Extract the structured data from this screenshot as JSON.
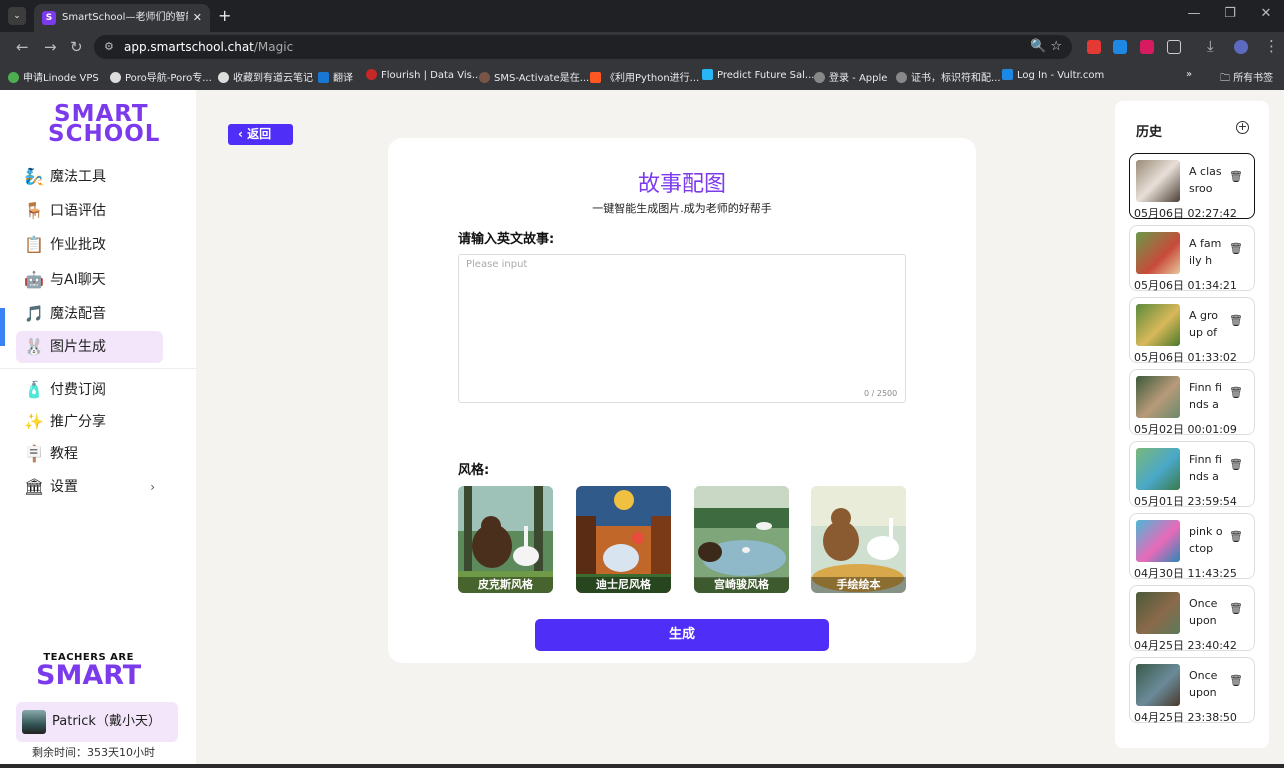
{
  "browser": {
    "tab_title": "SmartSchool—老师们的智能AI",
    "tab_icon_letter": "S",
    "url_host": "app.smartschool.chat",
    "url_path": "/Magic",
    "bookmarks": [
      "申请Linode VPS",
      "Poro导航-Poro专...",
      "收藏到有道云笔记",
      "翻译",
      "Flourish | Data Vis...",
      "SMS-Activate是在...",
      "《利用Python进行...",
      "Predict Future Sal...",
      "登录 - Apple",
      "证书，标识符和配...",
      "Log In - Vultr.com"
    ],
    "all_bookmarks": "所有书签"
  },
  "brand": {
    "logo_line1": "SMART",
    "logo_line2": "SCHOOL",
    "slogan_line1": "TEACHERS ARE",
    "slogan_line2": "SMART"
  },
  "nav": {
    "items": [
      {
        "label": "魔法工具",
        "icon": "🧞"
      },
      {
        "label": "口语评估",
        "icon": "🪑"
      },
      {
        "label": "作业批改",
        "icon": "📋"
      },
      {
        "label": "与AI聊天",
        "icon": "🤖"
      },
      {
        "label": "魔法配音",
        "icon": "🎵"
      },
      {
        "label": "图片生成",
        "icon": "🐰"
      }
    ],
    "bottom_items": [
      {
        "label": "付费订阅",
        "icon": "🧴"
      },
      {
        "label": "推广分享",
        "icon": "✨"
      },
      {
        "label": "教程",
        "icon": "🪧"
      },
      {
        "label": "设置",
        "icon": "🏛"
      }
    ],
    "settings_chevron": "›"
  },
  "user": {
    "name": "Patrick（戴小天）",
    "remaining": "剩余时间：353天10小时"
  },
  "main": {
    "back_label": "返回",
    "title": "故事配图",
    "subtitle": "一键智能生成图片.成为老师的好帮手",
    "story_label": "请输入英文故事:",
    "story_placeholder": "Please input",
    "char_count": "0 / 2500",
    "style_label": "风格:",
    "styles": [
      "皮克斯风格",
      "迪士尼风格",
      "宫崎骏风格",
      "手绘绘本"
    ],
    "generate_label": "生成"
  },
  "history": {
    "title": "历史",
    "items": [
      {
        "text": "A classroom",
        "date": "05月06日 02:27:42"
      },
      {
        "text": "A family h",
        "date": "05月06日 01:34:21"
      },
      {
        "text": "A group of",
        "date": "05月06日 01:33:02"
      },
      {
        "text": "Finn finds a",
        "date": "05月02日 00:01:09"
      },
      {
        "text": "Finn finds a",
        "date": "05月01日 23:59:54"
      },
      {
        "text": "pink octop",
        "date": "04月30日 11:43:25"
      },
      {
        "text": "Once upon",
        "date": "04月25日 23:40:42"
      },
      {
        "text": "Once upon",
        "date": "04月25日 23:38:50"
      }
    ]
  }
}
